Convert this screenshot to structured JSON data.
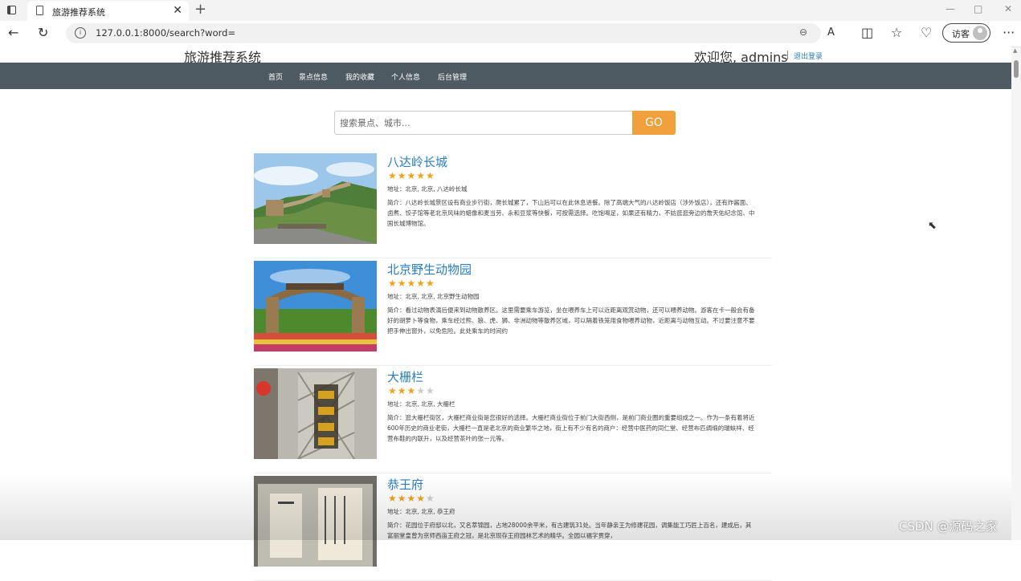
{
  "browser": {
    "tab_title": "旅游推荐系统",
    "tab_close": "✕",
    "new_tab": "+",
    "url": "127.0.0.1:8000/search?word=",
    "guest_label": "访客",
    "back": "←",
    "reload": "↻",
    "info": "i",
    "zoom": "⊖",
    "read_aloud": "A",
    "split": "◫",
    "favorites": "☆",
    "heart": "♡",
    "more": "···",
    "minimize": "—",
    "maximize": "□",
    "close": "✕"
  },
  "header": {
    "title": "旅游推荐系统",
    "welcome": "欢迎您, admins",
    "logout": "退出登录"
  },
  "nav": [
    "首页",
    "景点信息",
    "我的收藏",
    "个人信息",
    "后台管理"
  ],
  "search": {
    "placeholder": "搜索景点、城市...",
    "button": "GO"
  },
  "results": [
    {
      "name": "八达岭长城",
      "rating": 5,
      "address": "地址：北京, 北京, 八达岭长城",
      "description": "简介：八达岭长城景区设有商业步行街，爬长城累了，下山后可以在此休息进餐。除了高端大气的八达岭饭店（涉外饭店），还有炸酱面、卤煮、饺子馆等老北京风味的蜡像和麦当劳、永和豆浆等快餐，可按需选择。吃饱喝足，如果还有精力，不妨逛逛旁边的詹天佑纪念馆、中国长城博物馆。"
    },
    {
      "name": "北京野生动物园",
      "rating": 5,
      "address": "地址：北京, 北京, 北京野生动物园",
      "description": "简介：看过动物表演后便来到动物散养区。这里需要乘车游览，坐在喂养车上可以近距离观赏动物，还可以喂养动物。游客在卡一般会有备好的胡萝卜等食物，乘车经过熊、狼、虎、狮、非洲动物等散养区域，可以隔着铁笼用食物喂养动物，近距离与动物互动。不过要注意不要把手伸出窗外，以免危险。此处乘车的时间约"
    },
    {
      "name": "大栅栏",
      "rating": 3,
      "address": "地址：北京, 北京, 大栅栏",
      "description": "简介：逛大栅栏街区，大栅栏商业街是您很好的选择。大栅栏商业街位于前门大街西侧，是前门商业圈的重要组成之一。作为一条有着将近600年历史的商业老街，大栅栏一直是老北京的商业繁华之地，街上有不少有名的商户：经营中医药的同仁堂、经营布匹绸缎的瑞蚨祥、经营布鞋的内联升，以及经营茶叶的张一元等。"
    },
    {
      "name": "恭王府",
      "rating": 4,
      "address": "地址：北京, 北京, 恭王府",
      "description": "简介：花园位于府邸以北，又名萃锦园，占地28000余平米，有古建筑31处。当年静亲王为修建花园，调集能工巧匠上百名，建成后，其富丽堂皇曾为京师西亩王府之冠，是北京现存王府园林艺术的精华。全园以福字贯穿，"
    }
  ],
  "watermark": "CSDN @源码之家"
}
